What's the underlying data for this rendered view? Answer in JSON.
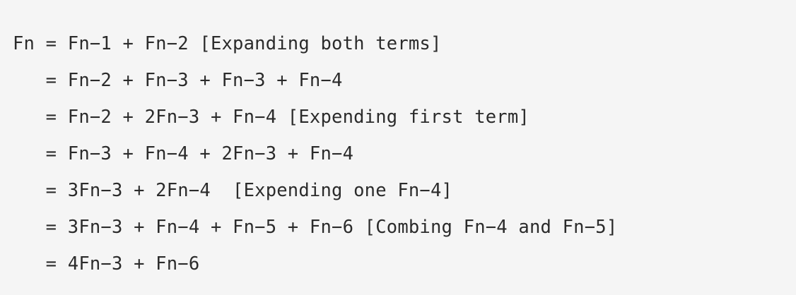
{
  "code_block": {
    "lines": [
      "Fn = Fn−1 + Fn−2 [Expanding both terms]",
      "   = Fn−2 + Fn−3 + Fn−3 + Fn−4",
      "   = Fn−2 + 2Fn−3 + Fn−4 [Expending first term]",
      "   = Fn−3 + Fn−4 + 2Fn−3 + Fn−4",
      "   = 3Fn−3 + 2Fn−4  [Expending one Fn−4]",
      "   = 3Fn−3 + Fn−4 + Fn−5 + Fn−6 [Combing Fn−4 and Fn−5]",
      "   = 4Fn−3 + Fn−6"
    ]
  },
  "colors": {
    "background": "#f5f5f5",
    "text": "#2b2b2b"
  }
}
